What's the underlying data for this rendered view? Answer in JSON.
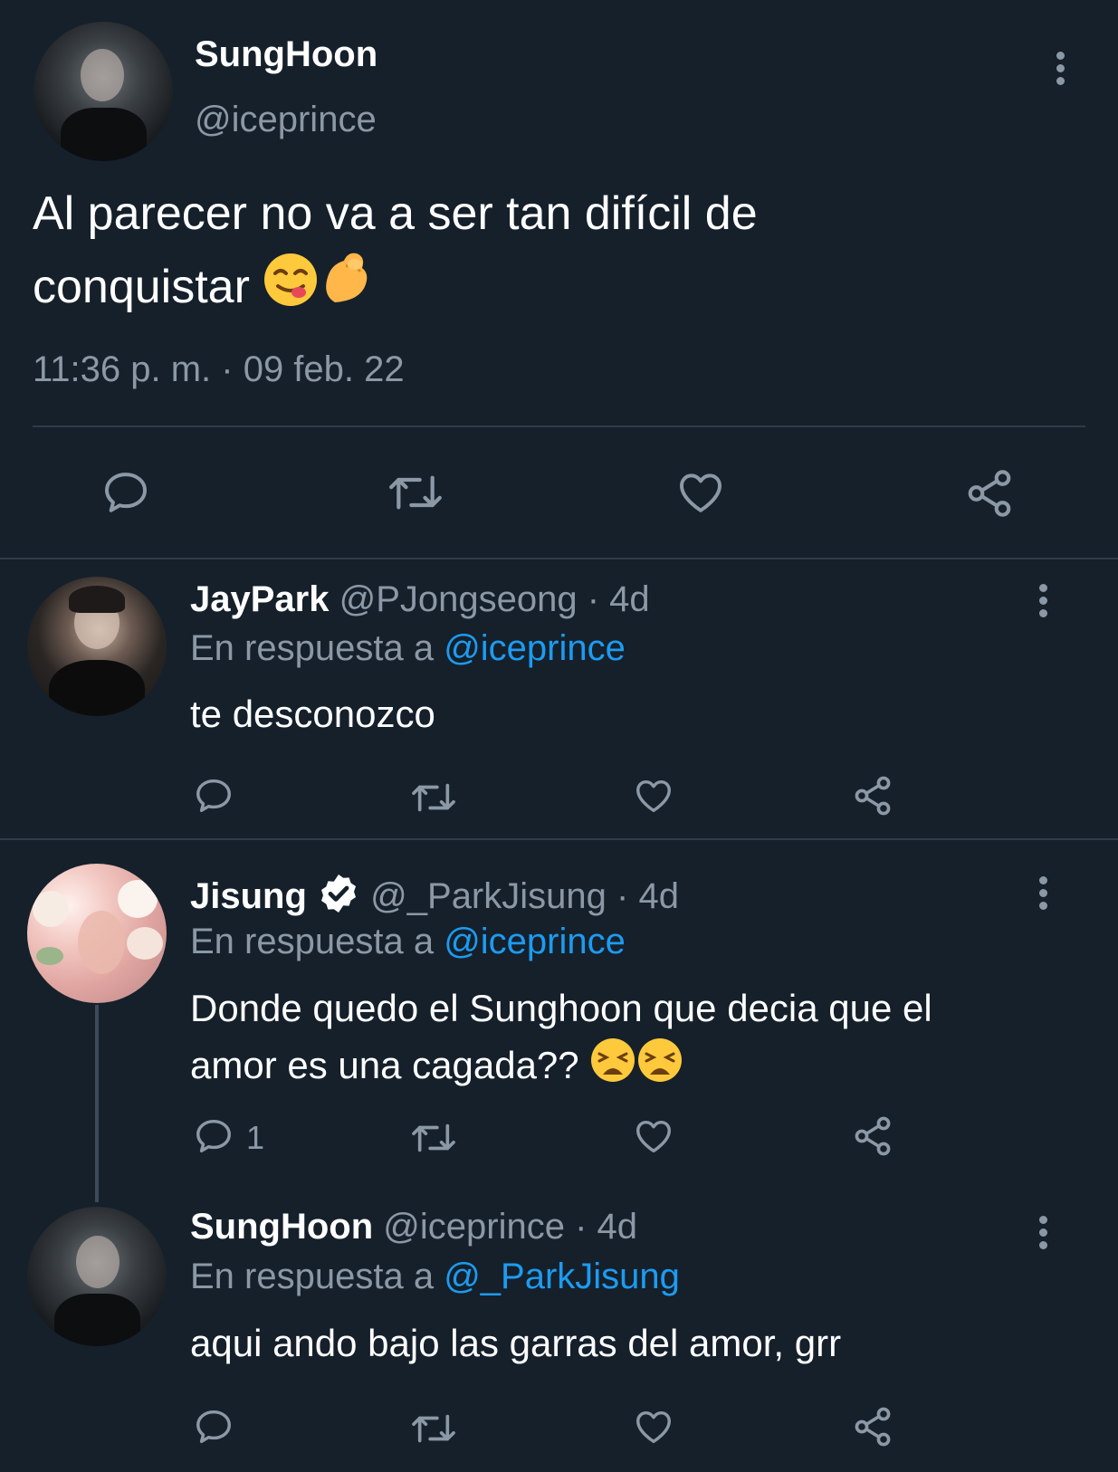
{
  "main_tweet": {
    "display_name": "SungHoon",
    "handle": "@iceprince",
    "text_line1": "Al parecer no va a ser tan difícil de",
    "text_line2": "conquistar",
    "timestamp": "11:36 p. m. · 09 feb. 22"
  },
  "replies": [
    {
      "display_name": "JayPark",
      "handle": "@PJongseong",
      "time": "· 4d",
      "reply_prefix": "En respuesta a",
      "reply_to": "@iceprince",
      "text": "te desconozco",
      "reply_count": ""
    },
    {
      "display_name": "Jisung",
      "handle": "@_ParkJisung",
      "time": "· 4d",
      "verified": true,
      "reply_prefix": "En respuesta a",
      "reply_to": "@iceprince",
      "text_line1": "Donde quedo el Sunghoon que decia que el",
      "text_line2": "amor es una cagada??",
      "reply_count": "1"
    },
    {
      "display_name": "SungHoon",
      "handle": "@iceprince",
      "time": "· 4d",
      "reply_prefix": "En respuesta a",
      "reply_to": "@_ParkJisung",
      "text": "aqui ando bajo las garras del amor, grr",
      "reply_count": ""
    }
  ],
  "icons": [
    "reply-icon",
    "retweet-icon",
    "like-icon",
    "share-icon",
    "more-icon",
    "verified-icon"
  ],
  "colors": {
    "background": "#15202b",
    "text": "#ffffff",
    "muted": "#8b98a5",
    "link": "#1d9bf0",
    "divider": "#2f3b47"
  }
}
